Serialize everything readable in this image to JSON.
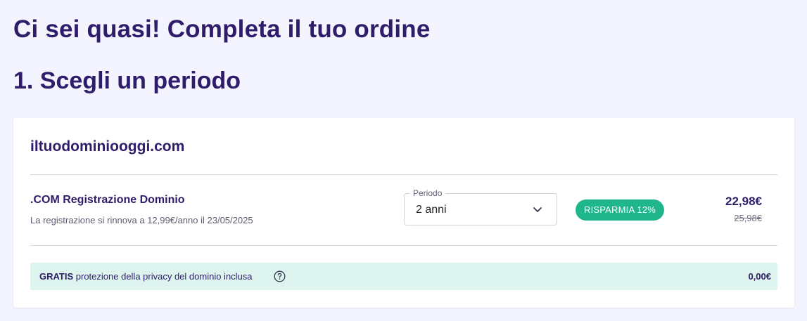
{
  "header": {
    "title": "Ci sei quasi! Completa il tuo ordine"
  },
  "step": {
    "title": "1. Scegli un periodo"
  },
  "domain": {
    "name": "iltuodominiooggi.com",
    "product_name": ".COM Registrazione Dominio",
    "renewal_note": "La registrazione si rinnova a 12,99€/anno il 23/05/2025",
    "period": {
      "label": "Periodo",
      "selected": "2 anni",
      "icon": "chevron-down-icon"
    },
    "savings_badge": "RISPARMIA 12%",
    "price_current": "22,98€",
    "price_old": "25,98€"
  },
  "privacy": {
    "strong_text": "GRATIS",
    "text": " protezione della privacy del dominio inclusa",
    "help_icon": "question-circle-icon",
    "price": "0,00€"
  },
  "colors": {
    "heading": "#2f1c6a",
    "background": "#f4f4ff",
    "badge": "#20b68c",
    "privacy_bar": "#def5ef"
  }
}
